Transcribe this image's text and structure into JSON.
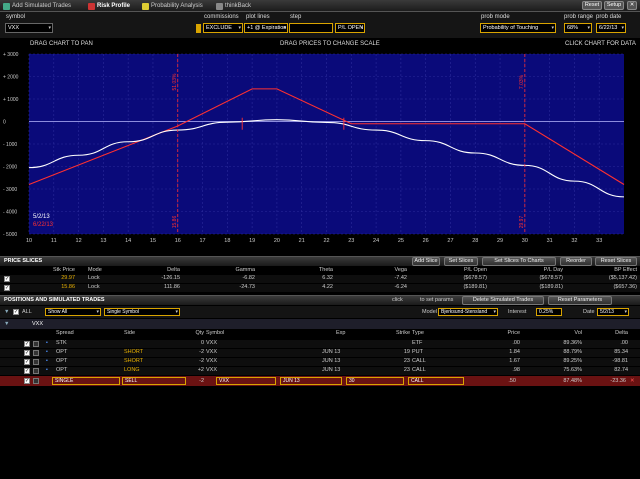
{
  "tabs": [
    {
      "label": "Add Simulated Trades",
      "icon": "add-trade-icon"
    },
    {
      "label": "Risk Profile",
      "icon": "risk-profile-icon",
      "active": true
    },
    {
      "label": "Probability Analysis",
      "icon": "probability-icon"
    },
    {
      "label": "thinkBack",
      "icon": "thinkback-icon"
    }
  ],
  "top_buttons": {
    "reset": "Reset",
    "setup": "Setup"
  },
  "controls": {
    "symbol_label": "symbol",
    "symbol_value": "VXX",
    "commissions_label": "commissions",
    "commissions_value": "EXCLUDE",
    "plot_lines_label": "plot lines",
    "plot_lines_value": "+1 @ Expiration",
    "step_label": "step",
    "pl_open_value": "P/L OPEN",
    "prob_mode_label": "prob mode",
    "prob_mode_value": "Probability of Touching",
    "prob_range_label": "prob range",
    "prob_range_value": "68%",
    "prob_date_label": "prob date",
    "prob_date_value": "6/22/13"
  },
  "chart_header": {
    "left": "DRAG CHART TO PAN",
    "center": "DRAG PRICES TO CHANGE SCALE",
    "right": "CLICK CHART FOR DATA"
  },
  "chart_data": {
    "type": "line",
    "xlim": [
      10,
      34
    ],
    "ylim": [
      -5000,
      3000
    ],
    "x_ticks": [
      "10",
      "11",
      "12",
      "13",
      "14",
      "15",
      "16",
      "17",
      "18",
      "19",
      "20",
      "21",
      "22",
      "23",
      "24",
      "25",
      "26",
      "27",
      "28",
      "29",
      "30",
      "31",
      "32",
      "33"
    ],
    "y_ticks": [
      {
        "v": 3000,
        "label": "+ 3000"
      },
      {
        "v": 2000,
        "label": "+ 2000"
      },
      {
        "v": 1000,
        "label": "+ 1000"
      },
      {
        "v": 0,
        "label": "0"
      },
      {
        "v": -1000,
        "label": "- 1000"
      },
      {
        "v": -2000,
        "label": "- 2000"
      },
      {
        "v": -3000,
        "label": "- 3000"
      },
      {
        "v": -4000,
        "label": "- 4000"
      },
      {
        "v": -5000,
        "label": "- 5000"
      }
    ],
    "series": [
      {
        "color": "#ff3030",
        "x": [
          10,
          16,
          19,
          20,
          23,
          30,
          34
        ],
        "y": [
          -2800,
          -200,
          1450,
          1450,
          -100,
          -100,
          -2800
        ]
      },
      {
        "color": "#ffffff",
        "x": [
          10,
          12,
          14,
          16,
          18,
          20,
          22,
          24,
          26,
          28,
          30,
          32,
          34
        ],
        "y": [
          -2050,
          -1500,
          -900,
          -380,
          -30,
          80,
          -40,
          -380,
          -850,
          -1400,
          -1950,
          -2650,
          -3350
        ]
      }
    ],
    "markers": [
      {
        "x": 16,
        "label": "51.03%",
        "bottom_label": "15.86",
        "color": "#ff3030"
      },
      {
        "x": 30,
        "label": "7.03%",
        "bottom_label": "29.97",
        "color": "#ff3030"
      }
    ],
    "date_labels": [
      "5/2/13",
      "6/22/13"
    ]
  },
  "price_slices": {
    "title": "PRICE SLICES",
    "buttons": [
      "Add Slice",
      "Set Slices",
      "Set Slices To Charts",
      "Reorder",
      "Reset Slices"
    ],
    "headers": [
      "Stk Price",
      "Mode",
      "Delta",
      "Gamma",
      "Theta",
      "Vega",
      "P/L Open",
      "P/L Day",
      "BP Effect"
    ],
    "rows": [
      {
        "price": "29.97",
        "mode": "Lock",
        "delta": "-126.15",
        "gamma": "-6.82",
        "theta": "6.32",
        "vega": "-7.42",
        "pl_open": "($678.57)",
        "pl_day": "($678.57)",
        "bp": "($5,137.42)",
        "price_color": "#e8b000"
      },
      {
        "price": "15.86",
        "mode": "Lock",
        "delta": "111.86",
        "gamma": "-24.73",
        "theta": "4.22",
        "vega": "-6.24",
        "pl_open": "($189.81)",
        "pl_day": "($189.81)",
        "bp": "($657.36)",
        "price_color": "#e8b000"
      }
    ]
  },
  "positions": {
    "title": "POSITIONS AND SIMULATED TRADES",
    "click_hint": "click",
    "click_hint2": "to set params",
    "delete_btn": "Delete Simulated Trades",
    "reset_btn": "Reset Parameters",
    "all_label": "ALL",
    "show_value": "Show All",
    "symbol_mode": "Single Symbol",
    "model_label": "Model",
    "model_value": "Bjerksund-Stensland",
    "interest_label": "Interest",
    "interest_value": "0.25%",
    "date_label": "Date",
    "date_value": "5/2/13",
    "group": "VXX",
    "headers": [
      "Spread",
      "Side",
      "Qty",
      "Symbol",
      "Exp",
      "Strike",
      "Type",
      "Price",
      "Vol",
      "Delta"
    ],
    "rows": [
      {
        "spread": "STK",
        "side": "",
        "qty": "0",
        "symbol": "VXX",
        "exp": "",
        "strike": "",
        "type": "ETF",
        "price": ".00",
        "vol": "89.36%",
        "delta": ".00"
      },
      {
        "spread": "OPT",
        "side": "SHORT",
        "qty": "-2",
        "symbol": "VXX",
        "exp": "JUN 13",
        "strike": "19",
        "type": "PUT",
        "price": "1.84",
        "vol": "88.79%",
        "delta": "85.34"
      },
      {
        "spread": "OPT",
        "side": "SHORT",
        "qty": "-2",
        "symbol": "VXX",
        "exp": "JUN 13",
        "strike": "23",
        "type": "CALL",
        "price": "1.67",
        "vol": "89.25%",
        "delta": "-98.81"
      },
      {
        "spread": "OPT",
        "side": "LONG",
        "qty": "+2",
        "symbol": "VXX",
        "exp": "JUN 13",
        "strike": "23",
        "type": "CALL",
        "price": ".98",
        "vol": "75.63%",
        "delta": "82.74"
      }
    ],
    "sim_row": {
      "spread": "SINGLE",
      "side": "SELL",
      "qty": "-2",
      "symbol": "VXX",
      "exp": "JUN 13",
      "strike": "30",
      "type": "CALL",
      "price": ".50",
      "vol": "87.48%",
      "delta": "-23.36"
    }
  },
  "colors": {
    "chart_bg": "#0a0a7a",
    "loss_line": "#ff3030",
    "model_line": "#ffffff",
    "accent": "#e8b000"
  }
}
